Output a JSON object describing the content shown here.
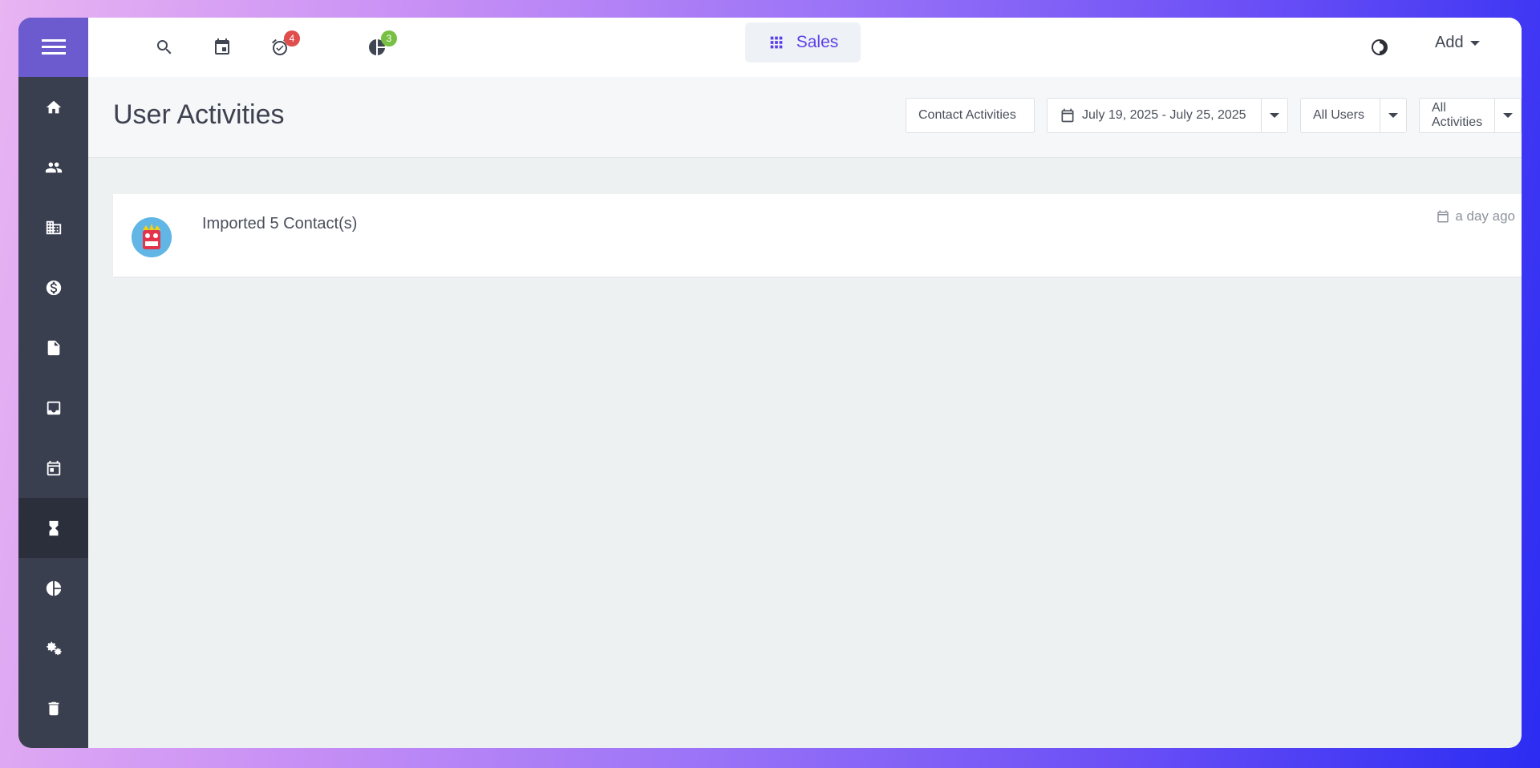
{
  "topbar": {
    "reminders_badge": "4",
    "reports_badge": "3",
    "app_label": "Sales",
    "add_label": "Add"
  },
  "header": {
    "title": "User Activities",
    "contact_activities": "Contact Activities",
    "date_range": "July 19, 2025 - July 25, 2025",
    "users_filter": "All Users",
    "activities_filter": "All Activities"
  },
  "activities": [
    {
      "text": "Imported 5 Contact(s)",
      "time": "a day ago"
    }
  ]
}
